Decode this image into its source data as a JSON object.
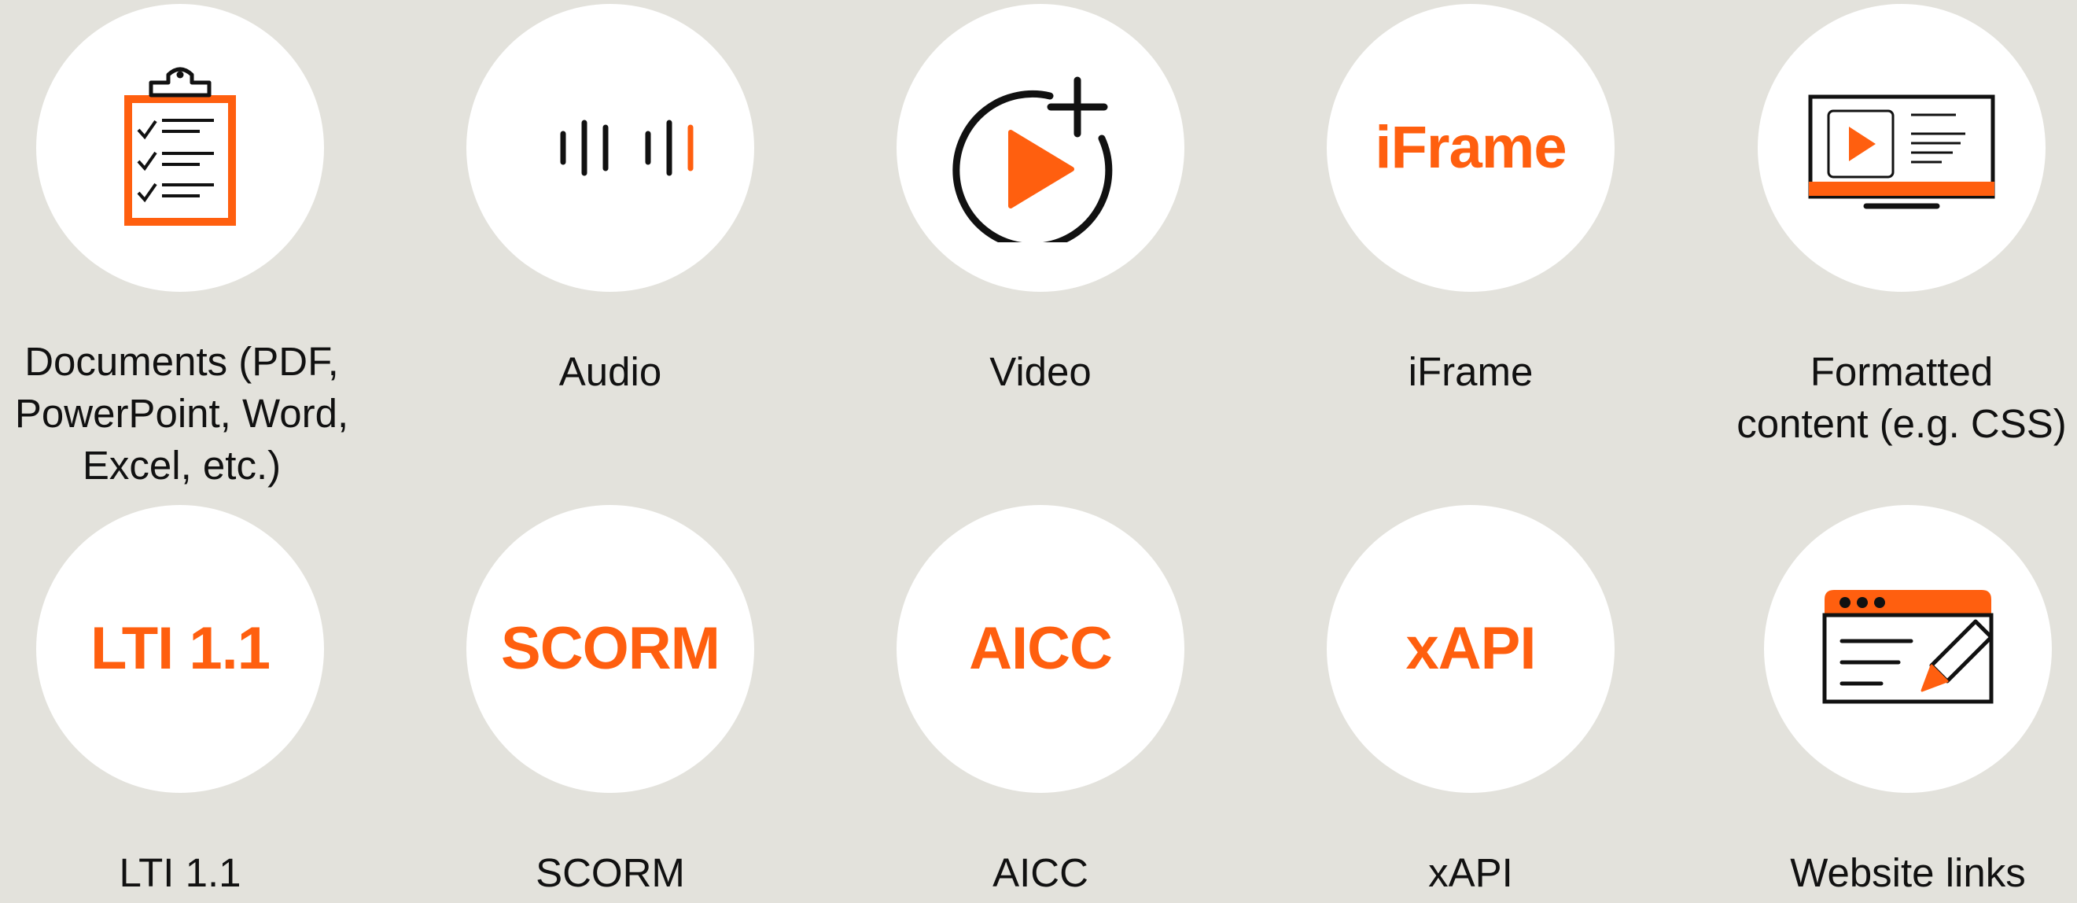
{
  "colors": {
    "background": "#e3e2dc",
    "circle": "#ffffff",
    "accent": "#ff5f0f",
    "ink": "#111111"
  },
  "items": [
    {
      "id": "documents",
      "icon": "clipboard-checklist-icon",
      "label_lines": [
        "Documents (PDF,",
        "PowerPoint, Word,",
        "Excel, etc.)"
      ]
    },
    {
      "id": "audio",
      "icon": "audio-waveform-icon",
      "label_lines": [
        "Audio"
      ]
    },
    {
      "id": "video",
      "icon": "video-play-add-icon",
      "label_lines": [
        "Video"
      ]
    },
    {
      "id": "iframe",
      "badge": "iFrame",
      "label_lines": [
        "iFrame"
      ]
    },
    {
      "id": "formatted",
      "icon": "monitor-content-icon",
      "label_lines": [
        "Formatted",
        "content (e.g. CSS)"
      ]
    },
    {
      "id": "lti",
      "badge": "LTI 1.1",
      "label_lines": [
        "LTI 1.1"
      ]
    },
    {
      "id": "scorm",
      "badge": "SCORM",
      "label_lines": [
        "SCORM"
      ]
    },
    {
      "id": "aicc",
      "badge": "AICC",
      "label_lines": [
        "AICC"
      ]
    },
    {
      "id": "xapi",
      "badge": "xAPI",
      "label_lines": [
        "xAPI"
      ]
    },
    {
      "id": "website",
      "icon": "browser-edit-icon",
      "label_lines": [
        "Website links"
      ]
    }
  ]
}
